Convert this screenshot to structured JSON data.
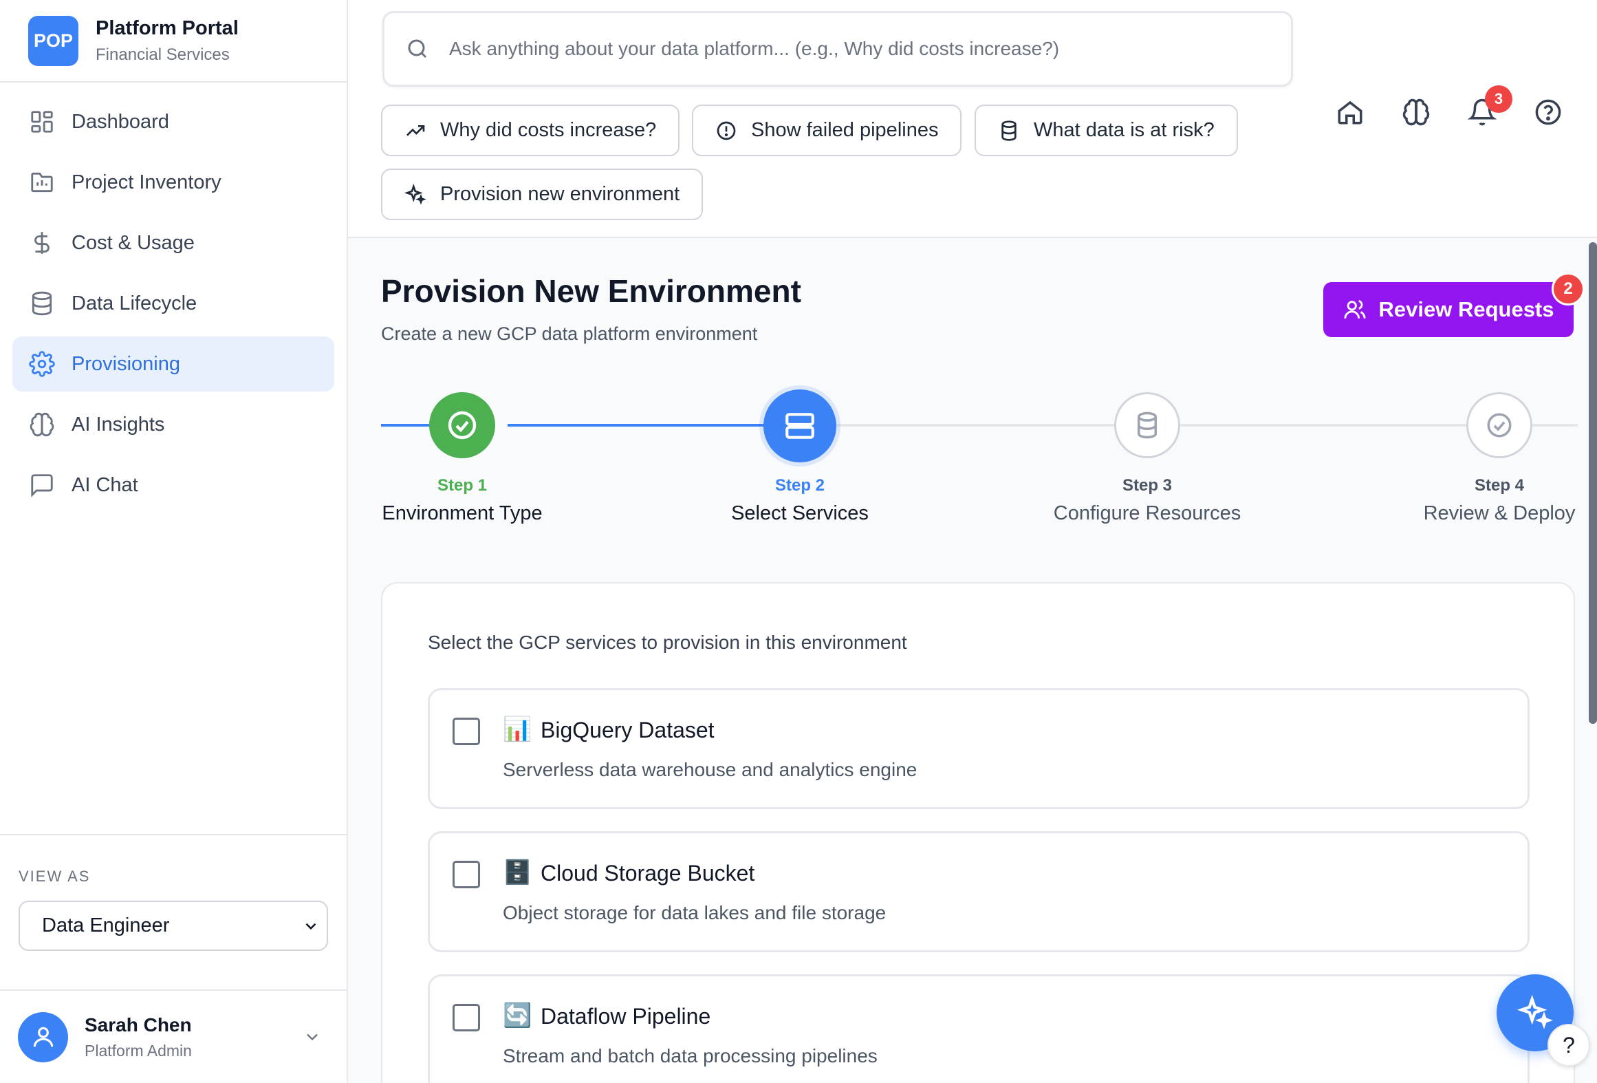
{
  "brand": {
    "logo_text": "POP",
    "title": "Platform Portal",
    "subtitle": "Financial Services",
    "color": "#3b82f6"
  },
  "sidebar": {
    "items": [
      {
        "label": "Dashboard",
        "icon": "dashboard-grid-icon",
        "active": false
      },
      {
        "label": "Project Inventory",
        "icon": "folder-chart-icon",
        "active": false
      },
      {
        "label": "Cost & Usage",
        "icon": "dollar-icon",
        "active": false
      },
      {
        "label": "Data Lifecycle",
        "icon": "database-icon",
        "active": false
      },
      {
        "label": "Provisioning",
        "icon": "gear-icon",
        "active": true
      },
      {
        "label": "AI Insights",
        "icon": "brain-icon",
        "active": false
      },
      {
        "label": "AI Chat",
        "icon": "chat-bubble-icon",
        "active": false
      }
    ],
    "view_as_label": "VIEW AS",
    "view_as_value": "Data Engineer"
  },
  "user": {
    "name": "Sarah Chen",
    "role": "Platform Admin"
  },
  "search": {
    "placeholder": "Ask anything about your data platform... (e.g., Why did costs increase?)"
  },
  "quick_prompts": [
    {
      "label": "Why did costs increase?",
      "icon": "trending-up-icon"
    },
    {
      "label": "Show failed pipelines",
      "icon": "alert-circle-icon"
    },
    {
      "label": "What data is at risk?",
      "icon": "database-icon"
    },
    {
      "label": "Provision new environment",
      "icon": "sparkles-icon"
    }
  ],
  "header_icons": {
    "notifications_count": "3"
  },
  "page": {
    "title": "Provision New Environment",
    "subtitle": "Create a new GCP data platform environment",
    "review_button": "Review Requests",
    "review_count": "2",
    "review_color": "#9315f0"
  },
  "steps": [
    {
      "num": "Step 1",
      "label": "Environment Type",
      "status": "complete",
      "color": "#4caf50"
    },
    {
      "num": "Step 2",
      "label": "Select Services",
      "status": "current",
      "color": "#3b82f6"
    },
    {
      "num": "Step 3",
      "label": "Configure Resources",
      "status": "pending",
      "color": "#6b7280"
    },
    {
      "num": "Step 4",
      "label": "Review & Deploy",
      "status": "pending",
      "color": "#6b7280"
    }
  ],
  "services": {
    "intro": "Select the GCP services to provision in this environment",
    "items": [
      {
        "emoji": "📊",
        "name": "BigQuery Dataset",
        "desc": "Serverless data warehouse and analytics engine",
        "checked": false
      },
      {
        "emoji": "🗄️",
        "name": "Cloud Storage Bucket",
        "desc": "Object storage for data lakes and file storage",
        "checked": false
      },
      {
        "emoji": "🔄",
        "name": "Dataflow Pipeline",
        "desc": "Stream and batch data processing pipelines",
        "checked": false
      }
    ]
  },
  "help_fab_label": "?"
}
